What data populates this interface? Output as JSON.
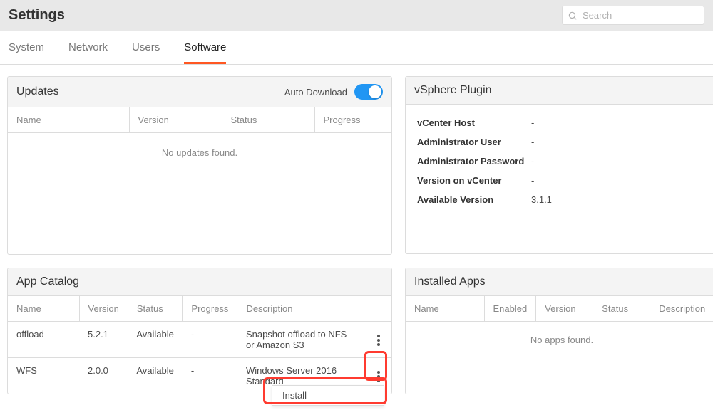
{
  "pageTitle": "Settings",
  "search": {
    "placeholder": "Search"
  },
  "tabs": [
    {
      "label": "System",
      "active": false
    },
    {
      "label": "Network",
      "active": false
    },
    {
      "label": "Users",
      "active": false
    },
    {
      "label": "Software",
      "active": true
    }
  ],
  "updates": {
    "title": "Updates",
    "autoDownloadLabel": "Auto Download",
    "columns": [
      "Name",
      "Version",
      "Status",
      "Progress"
    ],
    "emptyMessage": "No updates found."
  },
  "vspherePlugin": {
    "title": "vSphere Plugin",
    "rows": [
      {
        "k": "vCenter Host",
        "v": "-"
      },
      {
        "k": "Administrator User",
        "v": "-"
      },
      {
        "k": "Administrator Password",
        "v": "-"
      },
      {
        "k": "Version on vCenter",
        "v": "-"
      },
      {
        "k": "Available Version",
        "v": "3.1.1"
      }
    ]
  },
  "appCatalog": {
    "title": "App Catalog",
    "columns": [
      "Name",
      "Version",
      "Status",
      "Progress",
      "Description"
    ],
    "rows": [
      {
        "name": "offload",
        "version": "5.2.1",
        "status": "Available",
        "progress": "-",
        "description": "Snapshot offload to NFS or Amazon S3"
      },
      {
        "name": "WFS",
        "version": "2.0.0",
        "status": "Available",
        "progress": "-",
        "description": "Windows Server 2016 Standard"
      }
    ],
    "menu": {
      "install": "Install"
    }
  },
  "installedApps": {
    "title": "Installed Apps",
    "columns": [
      "Name",
      "Enabled",
      "Version",
      "Status",
      "Description"
    ],
    "emptyMessage": "No apps found."
  }
}
